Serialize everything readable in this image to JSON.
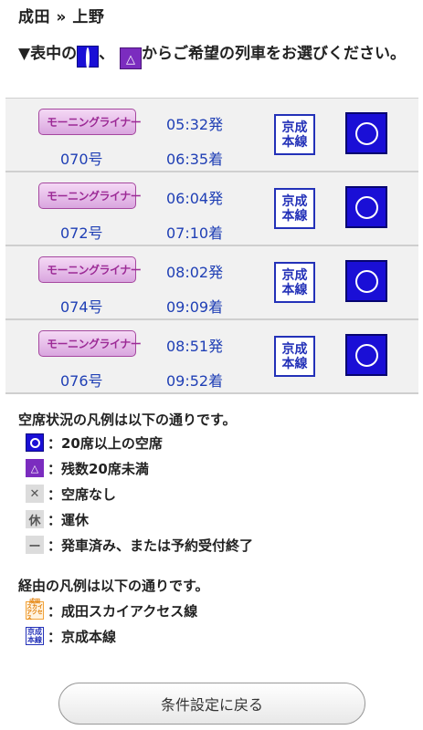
{
  "breadcrumb": "成田 » 上野",
  "instruction": {
    "prefix": "▼表中の",
    "sep": "、",
    "suffix": "からご希望の列車をお選びください。"
  },
  "trains": [
    {
      "name": "モーニングライナー",
      "number": "070号",
      "depart": "05:32発",
      "arrive": "06:35着",
      "route_line1": "京成",
      "route_line2": "本線",
      "seat": "○"
    },
    {
      "name": "モーニングライナー",
      "number": "072号",
      "depart": "06:04発",
      "arrive": "07:10着",
      "route_line1": "京成",
      "route_line2": "本線",
      "seat": "○"
    },
    {
      "name": "モーニングライナー",
      "number": "074号",
      "depart": "08:02発",
      "arrive": "09:09着",
      "route_line1": "京成",
      "route_line2": "本線",
      "seat": "○"
    },
    {
      "name": "モーニングライナー",
      "number": "076号",
      "depart": "08:51発",
      "arrive": "09:52着",
      "route_line1": "京成",
      "route_line2": "本線",
      "seat": "○"
    }
  ],
  "seat_legend": {
    "title": "空席状況の凡例は以下の通りです。",
    "items": [
      {
        "symbol": "○",
        "text": "：20席以上の空席"
      },
      {
        "symbol": "△",
        "text": "：残数20席未満"
      },
      {
        "symbol": "✕",
        "text": "：空席なし"
      },
      {
        "symbol": "休",
        "text": "：運休"
      },
      {
        "symbol": "ー",
        "text": "：発車済み、または予約受付終了"
      }
    ]
  },
  "route_legend": {
    "title": "経由の凡例は以下の通りです。",
    "items": [
      {
        "icon_l1": "成田",
        "icon_l2": "スカイ",
        "icon_l3": "アクセス",
        "text": "：成田スカイアクセス線"
      },
      {
        "icon_l1": "京成",
        "icon_l2": "本線",
        "text": "：京成本線"
      }
    ]
  },
  "back_button": "条件設定に戻る",
  "colors": {
    "available": "#1a0fd6",
    "few": "#7b2cbf",
    "link_text": "#1f3fb5",
    "badge": "#9c2a96"
  }
}
